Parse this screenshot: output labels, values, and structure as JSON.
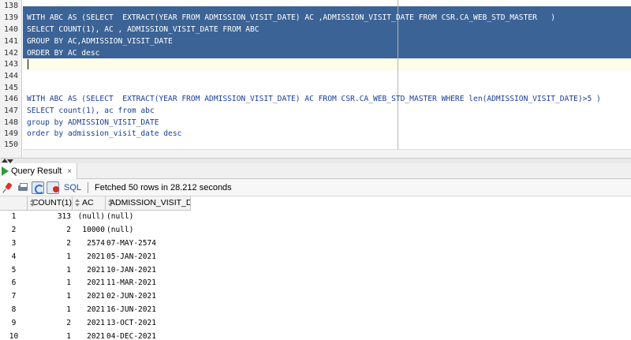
{
  "editor": {
    "lines": [
      {
        "num": "138",
        "text": ""
      },
      {
        "num": "139",
        "text": "WITH ABC AS (SELECT  EXTRACT(YEAR FROM ADMISSION_VISIT_DATE) AC ,ADMISSION_VISIT_DATE FROM CSR.CA_WEB_STD_MASTER   )"
      },
      {
        "num": "140",
        "text": "SELECT COUNT(1), AC , ADMISSION_VISIT_DATE FROM ABC"
      },
      {
        "num": "141",
        "text": "GROUP BY AC,ADMISSION_VISIT_DATE"
      },
      {
        "num": "142",
        "text": "ORDER BY AC desc"
      },
      {
        "num": "143",
        "text": ""
      },
      {
        "num": "144",
        "text": ""
      },
      {
        "num": "145",
        "text": ""
      },
      {
        "num": "146",
        "text": "WITH ABC AS (SELECT  EXTRACT(YEAR FROM ADMISSION_VISIT_DATE) AC FROM CSR.CA_WEB_STD_MASTER WHERE len(ADMISSION_VISIT_DATE)>5 )"
      },
      {
        "num": "147",
        "text": "SELECT count(1), ac from abc"
      },
      {
        "num": "148",
        "text": "group by ADMISSION_VISIT_DATE"
      },
      {
        "num": "149",
        "text": "order by admission_visit_date desc"
      },
      {
        "num": "150",
        "text": ""
      }
    ]
  },
  "result_tab": {
    "label": "Query Result",
    "close": "×"
  },
  "toolbar": {
    "sql_label": "SQL",
    "status": "Fetched 50 rows in 28.212 seconds"
  },
  "grid": {
    "headers": [
      "COUNT(1)",
      "AC",
      "ADMISSION_VISIT_DATE"
    ],
    "rows": [
      {
        "n": "1",
        "count": "313",
        "ac": "(null)",
        "date": "(null)"
      },
      {
        "n": "2",
        "count": "2",
        "ac": "10000",
        "date": "(null)"
      },
      {
        "n": "3",
        "count": "2",
        "ac": "2574",
        "date": "07-MAY-2574"
      },
      {
        "n": "4",
        "count": "1",
        "ac": "2021",
        "date": "05-JAN-2021"
      },
      {
        "n": "5",
        "count": "1",
        "ac": "2021",
        "date": "10-JAN-2021"
      },
      {
        "n": "6",
        "count": "1",
        "ac": "2021",
        "date": "11-MAR-2021"
      },
      {
        "n": "7",
        "count": "1",
        "ac": "2021",
        "date": "02-JUN-2021"
      },
      {
        "n": "8",
        "count": "1",
        "ac": "2021",
        "date": "16-JUN-2021"
      },
      {
        "n": "9",
        "count": "2",
        "ac": "2021",
        "date": "13-OCT-2021"
      },
      {
        "n": "10",
        "count": "1",
        "ac": "2021",
        "date": "04-DEC-2021"
      }
    ]
  },
  "colors": {
    "selection": "#3c6395",
    "keyword": "#1b3d99",
    "run_icon": "#2c9e3b"
  },
  "icons": [
    "pin-icon",
    "print-icon",
    "refresh-icon",
    "cancel-icon",
    "sort-icon",
    "run-icon"
  ]
}
